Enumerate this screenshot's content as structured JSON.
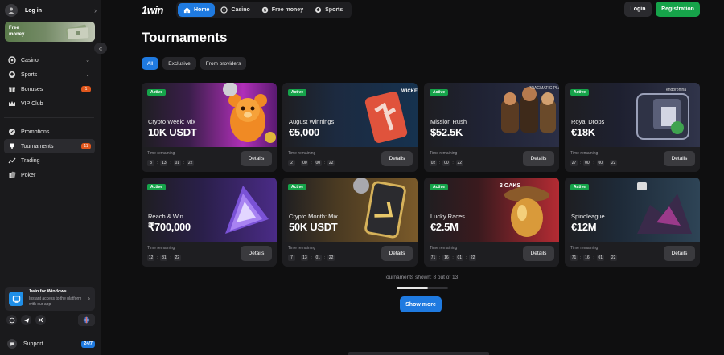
{
  "sidebar": {
    "login": "Log in",
    "free_money": "Free money",
    "nav_top": [
      {
        "label": "Casino",
        "icon": "casino-chip-icon",
        "chevron": true
      },
      {
        "label": "Sports",
        "icon": "ball-icon",
        "chevron": true
      },
      {
        "label": "Bonuses",
        "icon": "gift-icon",
        "badge": "1"
      },
      {
        "label": "VIP Club",
        "icon": "crown-icon"
      }
    ],
    "nav_bottom": [
      {
        "label": "Promotions",
        "icon": "promo-icon"
      },
      {
        "label": "Tournaments",
        "icon": "trophy-icon",
        "badge": "11",
        "active": true
      },
      {
        "label": "Trading",
        "icon": "chart-icon"
      },
      {
        "label": "Poker",
        "icon": "cards-icon"
      }
    ],
    "app_card": {
      "title": "1win for Windows",
      "subtitle": "Instant access to the platform with our app"
    },
    "support": "Support",
    "support_badge": "24/7"
  },
  "header": {
    "logo": "1win",
    "nav": [
      {
        "label": "Home",
        "active": true
      },
      {
        "label": "Casino"
      },
      {
        "label": "Free money"
      },
      {
        "label": "Sports"
      }
    ],
    "login": "Login",
    "register": "Registration"
  },
  "main": {
    "title": "Tournaments",
    "filters": [
      {
        "label": "All",
        "active": true
      },
      {
        "label": "Exclusive"
      },
      {
        "label": "From providers"
      }
    ],
    "time_label": "Time remaining",
    "details_label": "Details",
    "active_label": "Active",
    "cards": [
      {
        "name": "Crypto Week: Mix",
        "prize": "10K USDT",
        "timer": [
          "3",
          "13",
          "01",
          "22"
        ],
        "art": "bear"
      },
      {
        "name": "August Winnings",
        "prize": "€5,000",
        "timer": [
          "2",
          "00",
          "00",
          "22"
        ],
        "art": "wicked"
      },
      {
        "name": "Mission Rush",
        "prize": "$52.5K",
        "timer": [
          "02",
          "00",
          "22"
        ],
        "art": "pragmatic"
      },
      {
        "name": "Royal Drops",
        "prize": "€18K",
        "timer": [
          "27",
          "00",
          "00",
          "22"
        ],
        "art": "endorphina"
      },
      {
        "name": "Reach & Win",
        "prize": "₹700,000",
        "timer": [
          "12",
          "31",
          "22"
        ],
        "art": "crystal"
      },
      {
        "name": "Crypto Month: Mix",
        "prize": "50K USDT",
        "timer": [
          "7",
          "13",
          "01",
          "22"
        ],
        "art": "crypto"
      },
      {
        "name": "Lucky Races",
        "prize": "€2.5M",
        "timer": [
          "71",
          "16",
          "01",
          "22"
        ],
        "art": "acorn"
      },
      {
        "name": "Spinoleague",
        "prize": "€12M",
        "timer": [
          "71",
          "16",
          "01",
          "22"
        ],
        "art": "spino"
      }
    ],
    "art_labels": {
      "wicked": "WICKED GAMES",
      "pragmatic": "PRAGMATIC PLAY",
      "endorphina": "endorphina",
      "oaks": "3 OAKS"
    },
    "shown_text": "Tournaments shown: 8 out of 13",
    "progress": 0.615,
    "show_more": "Show more"
  }
}
